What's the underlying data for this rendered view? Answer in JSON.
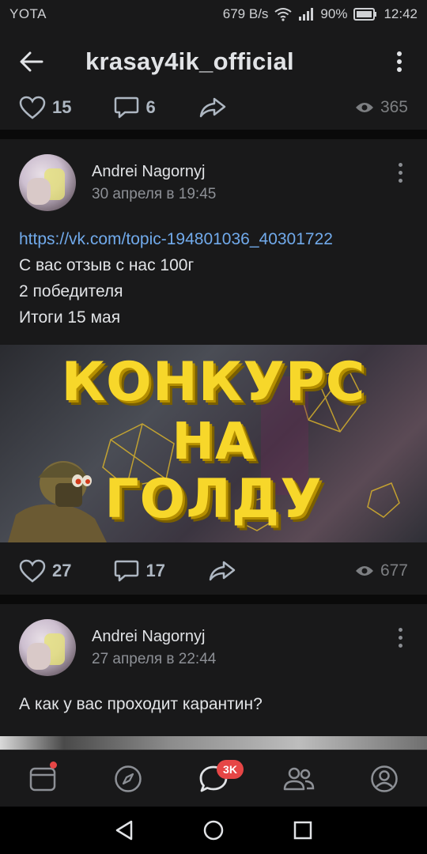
{
  "status_bar": {
    "carrier": "YOTA",
    "speed": "679 B/s",
    "battery": "90%",
    "time": "12:42"
  },
  "header": {
    "title": "krasay4ik_official",
    "back_icon": "arrow-left-icon",
    "menu_icon": "more-vertical-icon"
  },
  "colors": {
    "background": "#0a0a0a",
    "card": "#19191a",
    "text": "#e1e3e6",
    "secondary": "#8d9096",
    "link": "#71aaeb",
    "badge": "#e64646",
    "promo_yellow": "#f7d72a"
  },
  "prev_post": {
    "likes": "15",
    "comments": "6",
    "views": "365"
  },
  "posts": [
    {
      "author": "Andrei Nagornyj",
      "date": "30 апреля в 19:45",
      "link": "https://vk.com/topic-194801036_40301722",
      "lines": [
        "С вас отзыв с нас 100г",
        "2 победителя",
        "Итоги 15 мая"
      ],
      "image_text": [
        "КОНКУРС",
        "НА",
        "ГОЛДУ"
      ],
      "likes": "27",
      "comments": "17",
      "views": "677"
    },
    {
      "author": "Andrei Nagornyj",
      "date": "27 апреля в 22:44",
      "text": "А как у вас проходит карантин?"
    }
  ],
  "bottom_nav": {
    "items": [
      "news-icon",
      "discover-icon",
      "messages-icon",
      "friends-icon",
      "profile-icon"
    ],
    "messages_badge": "3K"
  }
}
